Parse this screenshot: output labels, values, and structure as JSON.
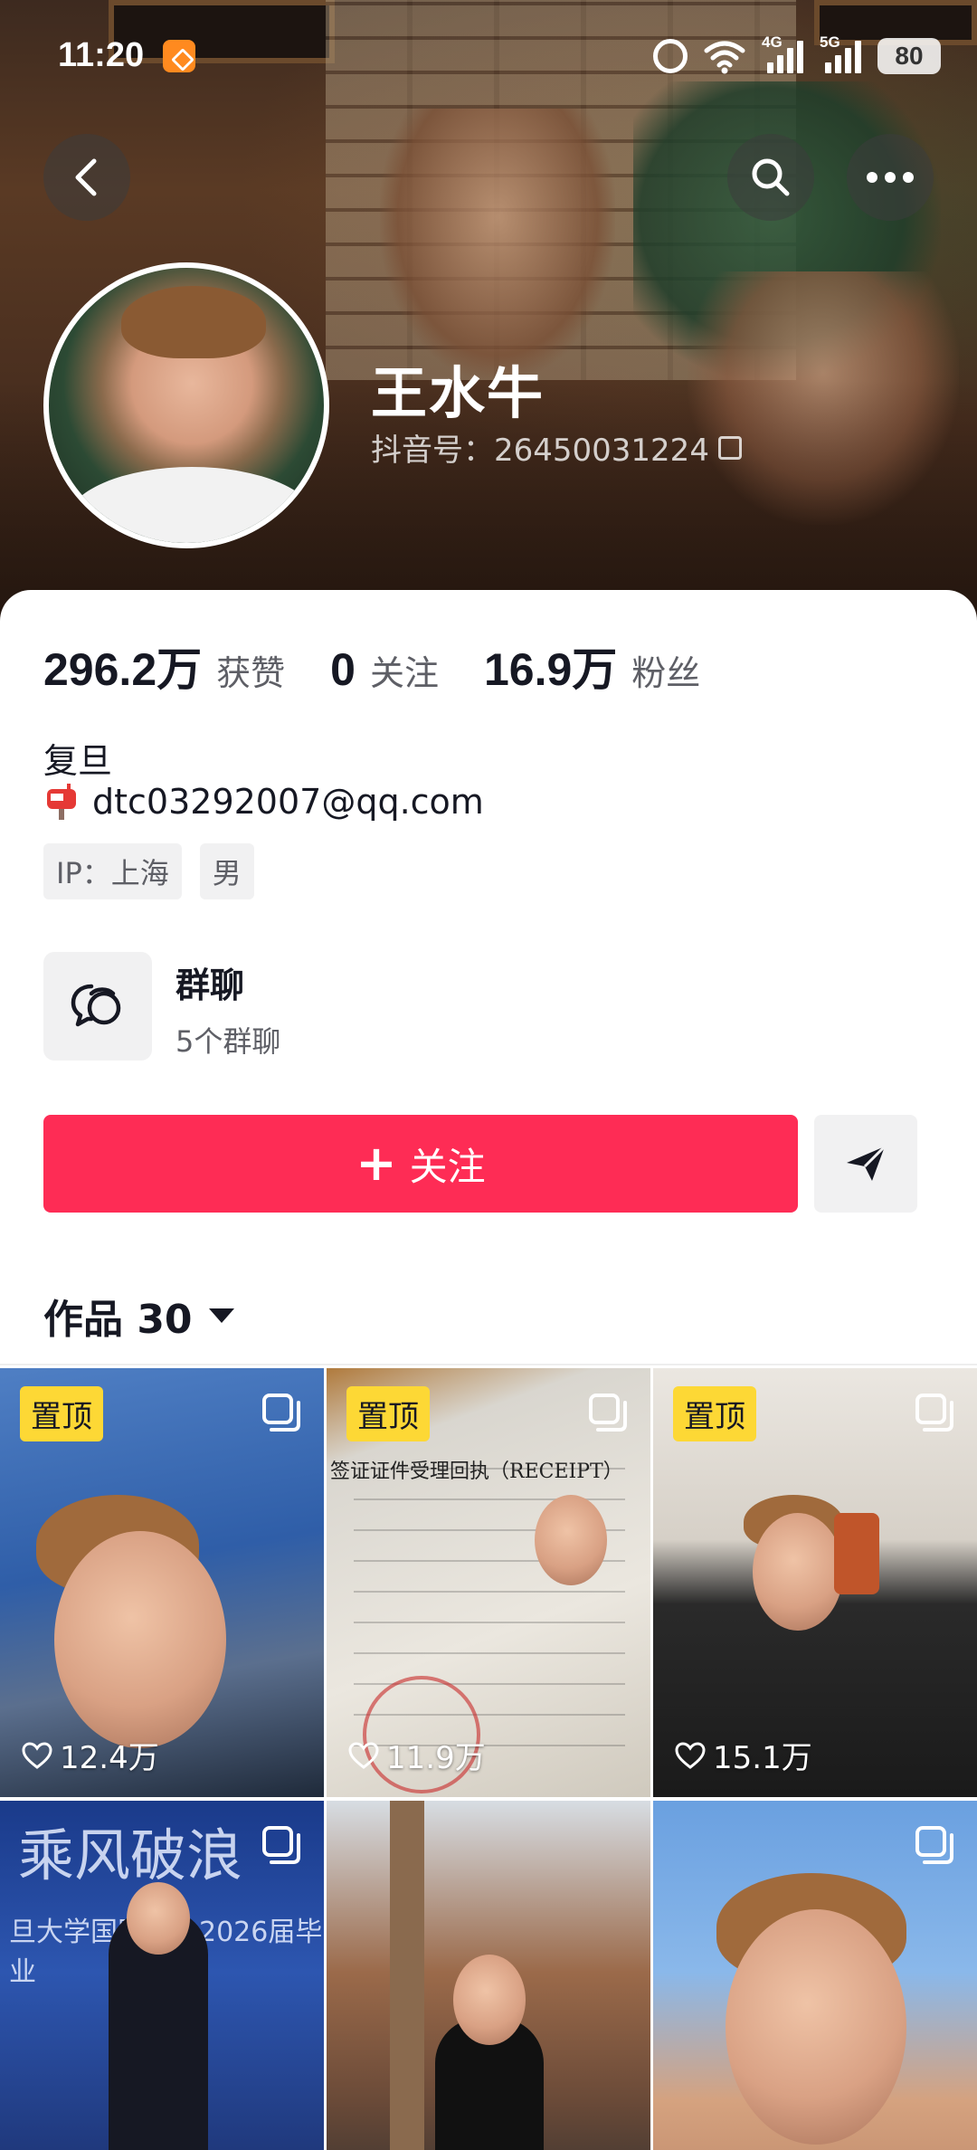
{
  "status_bar": {
    "time": "11:20",
    "network_1": "4G",
    "network_2": "5G",
    "battery": "80"
  },
  "profile": {
    "name": "王水牛",
    "douyin_id": "抖音号：26450031224"
  },
  "stats": [
    {
      "value": "296.2万",
      "label": "获赞"
    },
    {
      "value": "0",
      "label": "关注"
    },
    {
      "value": "16.9万",
      "label": "粉丝"
    }
  ],
  "bio": {
    "line1": "复旦",
    "email": "dtc03292007@qq.com"
  },
  "tags": [
    "IP：上海",
    "男"
  ],
  "group_chat": {
    "title": "群聊",
    "subtitle": "5个群聊"
  },
  "actions": {
    "follow_label": "关注"
  },
  "works_tab": {
    "label": "作品 30"
  },
  "grid": {
    "pinned_label": "置顶",
    "tiles": [
      {
        "pinned": true,
        "likes": "12.4万"
      },
      {
        "pinned": true,
        "likes": "11.9万",
        "doc_title": "签证证件受理回执（RECEIPT）"
      },
      {
        "pinned": true,
        "likes": "15.1万"
      },
      {
        "pinned": false,
        "banner": "乘风破浪",
        "banner_sub": "旦大学国际文…2026届毕业"
      },
      {
        "pinned": false
      },
      {
        "pinned": false
      }
    ]
  },
  "colors": {
    "accent": "#fe2c55",
    "pin_badge": "#fdd835",
    "text_primary": "#161823",
    "text_secondary": "#5e5f66"
  }
}
